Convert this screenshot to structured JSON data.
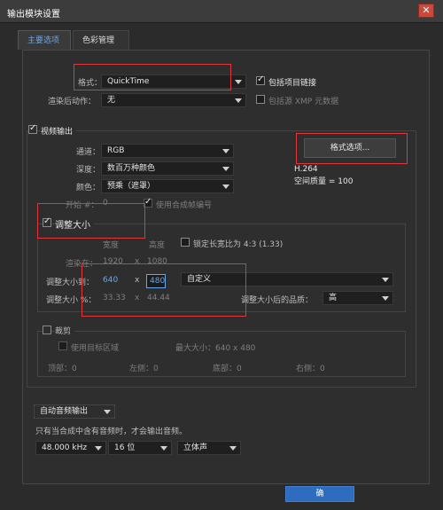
{
  "window": {
    "title": "输出模块设置",
    "close": "✕"
  },
  "tabs": [
    {
      "label": "主要选项"
    },
    {
      "label": "色彩管理"
    }
  ],
  "main": {
    "format_label": "格式：",
    "format_value": "QuickTime",
    "include_project_link": "包括项目链接",
    "post_render_label": "渲染后动作：",
    "post_render_value": "无",
    "include_xmp": "包括源 XMP 元数据"
  },
  "video": {
    "section_label": "视频输出",
    "channel_label": "通道：",
    "channel_value": "RGB",
    "depth_label": "深度：",
    "depth_value": "数百万种颜色",
    "color_label": "颜色：",
    "color_value": "预乘（遮罩）",
    "start_label": "开始 #：",
    "start_value": "0",
    "use_comp_frame": "使用合成帧编号",
    "format_options_btn": "格式选项...",
    "codec": "H.264",
    "spatial_quality": "空间质量 = 100"
  },
  "resize": {
    "label": "调整大小",
    "width_header": "宽度",
    "height_header": "高度",
    "lock_aspect": "锁定长宽比为 4:3 (1.33)",
    "render_at_label": "渲染在：",
    "render_w": "1920",
    "x": "x",
    "render_h": "1080",
    "resize_to_label": "调整大小到：",
    "resize_w": "640",
    "resize_h": "480",
    "preset": "自定义",
    "percent_label": "调整大小 %：",
    "percent_w": "33.33",
    "percent_h": "44.44",
    "quality_label": "调整大小后的品质：",
    "quality_value": "高"
  },
  "crop": {
    "label": "裁剪",
    "use_roi": "使用目标区域",
    "max_size": "最大大小：640 x 480",
    "top": "顶部：0",
    "left": "左侧：0",
    "bottom": "底部：0",
    "right": "右侧：0"
  },
  "audio": {
    "mode": "自动音频输出",
    "note": "只有当合成中含有音频时，才会输出音频。",
    "rate": "48.000 kHz",
    "bits": "16 位",
    "channels": "立体声"
  },
  "footer": {
    "ok_label": "确"
  },
  "colors": {
    "highlight": "#e2373a",
    "accent": "#6aa7e8"
  }
}
